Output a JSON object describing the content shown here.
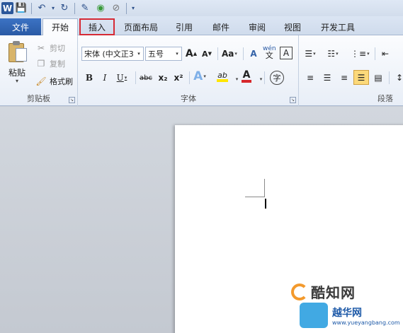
{
  "qat": {
    "app_icon": "W",
    "items": [
      {
        "icon": "save-icon",
        "glyph": "💾"
      },
      {
        "icon": "undo-icon",
        "glyph": "↶"
      },
      {
        "icon": "undo-dropdown-icon",
        "glyph": "▾"
      },
      {
        "icon": "redo-icon",
        "glyph": "↻"
      },
      {
        "icon": "format-painter-icon",
        "glyph": "✎"
      },
      {
        "icon": "color-icon",
        "glyph": "◉"
      },
      {
        "icon": "strike-icon",
        "glyph": "⊘"
      },
      {
        "icon": "customize-icon",
        "glyph": "▾"
      }
    ]
  },
  "tabs": [
    "文件",
    "开始",
    "插入",
    "页面布局",
    "引用",
    "邮件",
    "审阅",
    "视图",
    "开发工具"
  ],
  "clipboard": {
    "paste_label": "粘贴",
    "cut_label": "剪切",
    "copy_label": "复制",
    "format_painter_label": "格式刷",
    "group_label": "剪贴板"
  },
  "font": {
    "font_name": "宋体 (中文正3",
    "font_size": "五号",
    "grow_label": "A",
    "shrink_label": "A",
    "case_label": "Aa",
    "clear_label": "A",
    "phonetic_label": "wén",
    "char_border_label": "A",
    "bold_label": "B",
    "italic_label": "I",
    "underline_label": "U",
    "strike_label": "abc",
    "subscript_label": "x₂",
    "superscript_label": "x²",
    "effects_label": "A",
    "highlight_label": "ab",
    "font_color_label": "A",
    "enclose_label": "字",
    "group_label": "字体",
    "font_color": "#d6282c",
    "highlight_color": "#ffe600"
  },
  "paragraph": {
    "group_label": "段落"
  },
  "watermarks": {
    "brand1": "酷知网",
    "brand2": "越华网",
    "url2": "www.yueyangbang.com"
  }
}
